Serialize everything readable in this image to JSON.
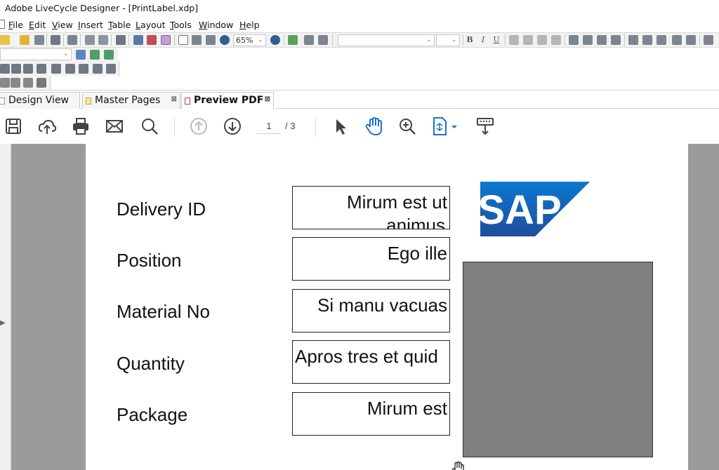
{
  "window": {
    "title": "Adobe LiveCycle Designer - [PrintLabel.xdp]"
  },
  "menu": [
    {
      "label": "File",
      "u": "F",
      "rest": "ile"
    },
    {
      "label": "Edit",
      "u": "E",
      "rest": "dit"
    },
    {
      "label": "View",
      "u": "V",
      "rest": "iew"
    },
    {
      "label": "Insert",
      "u": "I",
      "rest": "nsert"
    },
    {
      "label": "Table",
      "u": "T",
      "rest": "able"
    },
    {
      "label": "Layout",
      "u": "L",
      "rest": "ayout"
    },
    {
      "label": "Tools",
      "u": "T",
      "rest": "ools"
    },
    {
      "label": "Window",
      "u": "W",
      "rest": "indow"
    },
    {
      "label": "Help",
      "u": "H",
      "rest": "elp"
    }
  ],
  "toolbar": {
    "zoom": "65%"
  },
  "tabs": [
    {
      "label": "Design View",
      "active": false
    },
    {
      "label": "Master Pages",
      "active": false
    },
    {
      "label": "Preview PDF",
      "active": true
    }
  ],
  "pdf_toolbar": {
    "page_current": "1",
    "page_total": "/ 3"
  },
  "form": {
    "fields": [
      {
        "label": "Delivery ID",
        "value": "Mirum est ut",
        "value_line2": "animus"
      },
      {
        "label": "Position",
        "value": "Ego ille"
      },
      {
        "label": "Material No",
        "value": "Si manu vacuas"
      },
      {
        "label": "Quantity",
        "value": "Apros tres et quid"
      },
      {
        "label": "Package",
        "value": "Mirum est"
      }
    ],
    "logo_text": "SAP"
  },
  "colors": {
    "sap_blue_top": "#0b6fc3",
    "sap_blue_bottom": "#1e4f9c",
    "pdf_icon_blue": "#1a73c9",
    "viewer_gray": "#9b9b9b",
    "placeholder_gray": "#808080"
  }
}
